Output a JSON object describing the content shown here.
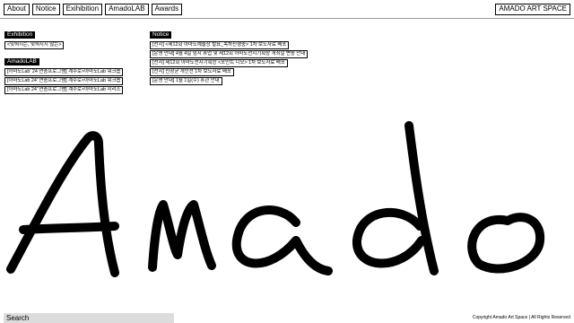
{
  "nav": {
    "items": [
      {
        "label": "About"
      },
      {
        "label": "Notice"
      },
      {
        "label": "Exihibition"
      },
      {
        "label": "AmadoLAB"
      },
      {
        "label": "Awards"
      }
    ],
    "brand": "AMADO ART SPACE"
  },
  "exhibition": {
    "heading": "Exhibition",
    "items": [
      "<잊혀지는, 잊혀지지 않는>"
    ]
  },
  "amadolab": {
    "heading": "AmadoLAB",
    "items": [
      "[아마도Lab' 24 연중프로그램] 계주로×아마도Lab 워크숍",
      "[아마도Lab 24' 연중프로그램] 계주로×아마도Lab 워크숍",
      "[아마도Lab 24' 연중프로그램] 계주로×아마도Lab 시리즈"
    ]
  },
  "notice": {
    "heading": "Notice",
    "items": [
      "[전시] <제12회 아마도예술상 발표_목하진행중> 1차 보도자료 배포",
      "[운영 안내] 4월 4일 임시 휴업 및 제12회 아마도전시기획상 개최일 변동 안내",
      "[전시] 제12회 아마도전시기획상 <포인트 니모> 1차 보도자료 배포",
      "[전시] 신창균 개인전 1차 보도자료 배포",
      "[운영 안내] 1월 1일(수) 휴관 안내"
    ]
  },
  "logo": {
    "text": "Amado"
  },
  "footer": {
    "search_label": "Search",
    "copyright": "Copyright Amado Art Space | All Rights Reserved"
  }
}
